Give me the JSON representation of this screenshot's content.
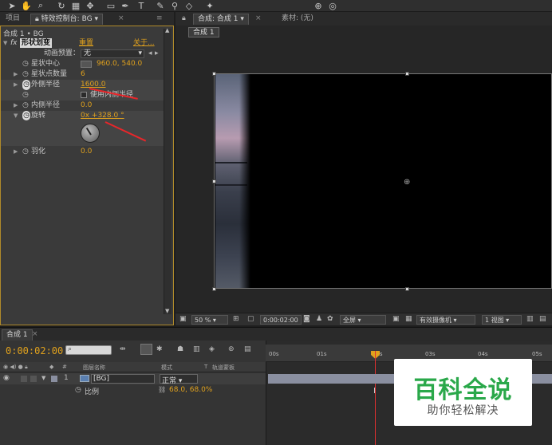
{
  "left_panel": {
    "tab_project": "项目",
    "tab_effects": "特效控制台: BG",
    "breadcrumb": "合成 1 • BG",
    "effect": {
      "fx": "fx",
      "name": "形状划变",
      "reset": "重置",
      "about": "关于..."
    },
    "preset_label": "动画预置：",
    "preset_value": "无",
    "properties": [
      {
        "name": "星状中心",
        "value": "960.0, 540.0"
      },
      {
        "name": "星状点数量",
        "value": "6"
      },
      {
        "name": "外侧半径",
        "value": "1600.0"
      },
      {
        "name": "使用内侧半径",
        "value": ""
      },
      {
        "name": "内侧半径",
        "value": "0.0"
      },
      {
        "name": "旋转",
        "value": "0x +328.0 °"
      },
      {
        "name": "羽化",
        "value": "0.0"
      }
    ]
  },
  "right_panel": {
    "tab_comp": "合成: 合成 1",
    "tab_footage": "素材: (无)",
    "sub_tab": "合成 1"
  },
  "viewer_bar": {
    "zoom": "50 %",
    "timecode": "0:00:02:00",
    "resolution": "全屏",
    "camera": "有效摄像机",
    "views": "1 视图"
  },
  "timeline": {
    "tab": "合成 1",
    "timecode": "0:00:02:00",
    "search_placeholder": "",
    "ticks": [
      "00s",
      "01s",
      "02s",
      "03s",
      "04s",
      "05s"
    ],
    "col_source": "图层名称",
    "col_mode": "模式",
    "col_t": "T",
    "col_trkmat": "轨道蒙板",
    "layer_index": "1",
    "layer_name": "[BG]",
    "layer_mode": "正常",
    "scale_label": "比例",
    "scale_value": "68.0, 68.0%"
  },
  "watermark": {
    "title": "百科全说",
    "subtitle": "助你轻松解决"
  },
  "colors": {
    "accent": "#e0a11d",
    "playhead": "#e03030",
    "watermark_green": "#2aa84a"
  }
}
